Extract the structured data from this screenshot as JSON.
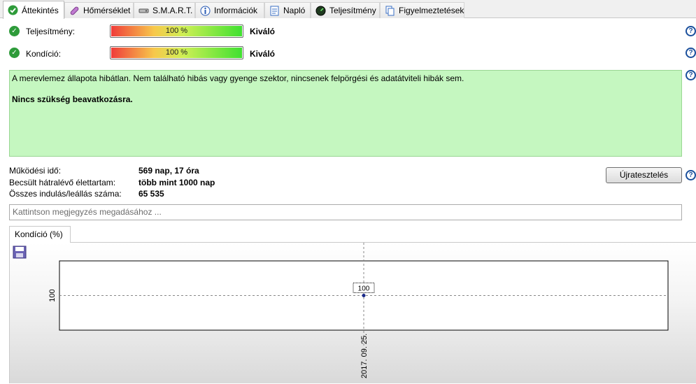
{
  "tabs": [
    {
      "label": "Áttekintés",
      "icon": "check-circle-icon",
      "active": true
    },
    {
      "label": "Hőmérséklet",
      "icon": "thermometer-icon",
      "active": false
    },
    {
      "label": "S.M.A.R.T.",
      "icon": "hard-drive-icon",
      "active": false
    },
    {
      "label": "Információk",
      "icon": "info-icon",
      "active": false
    },
    {
      "label": "Napló",
      "icon": "document-icon",
      "active": false
    },
    {
      "label": "Teljesítmény",
      "icon": "gauge-icon",
      "active": false
    },
    {
      "label": "Figyelmeztetések",
      "icon": "copy-icon",
      "active": false
    }
  ],
  "status": {
    "performance": {
      "label": "Teljesítmény:",
      "percent": 100,
      "percent_text": "100 %",
      "rating": "Kiváló"
    },
    "condition": {
      "label": "Kondíció:",
      "percent": 100,
      "percent_text": "100 %",
      "rating": "Kiváló"
    }
  },
  "summary": {
    "line1": "A merevlemez állapota hibátlan. Nem található hibás vagy gyenge szektor, nincsenek felpörgési és adatátviteli hibák sem.",
    "line2": "Nincs szükség beavatkozásra."
  },
  "info": {
    "uptime_label": "Működési idő:",
    "uptime_value": "569 nap, 17 óra",
    "lifetime_label": "Becsült hátralévő élettartam:",
    "lifetime_value": "több mint 1000 nap",
    "startstop_label": "Összes indulás/leállás száma:",
    "startstop_value": "65 535"
  },
  "retest_button": "Újratesztelés",
  "note_placeholder": "Kattintson megjegyzés megadásához ...",
  "chart_tab": "Kondíció  (%)",
  "help_glyph": "?",
  "chart_data": {
    "type": "line",
    "x": [
      "2017. 09. 25."
    ],
    "series": [
      {
        "values": [
          100
        ]
      }
    ],
    "data_labels": [
      "100"
    ],
    "y_ticks": [
      "100"
    ],
    "x_ticks": [
      "2017. 09. 25."
    ],
    "grid": true
  },
  "colors": {
    "ok_green": "#2e9b3a",
    "summary_bg": "#c5f7c0",
    "help_blue": "#1a4f9c"
  }
}
